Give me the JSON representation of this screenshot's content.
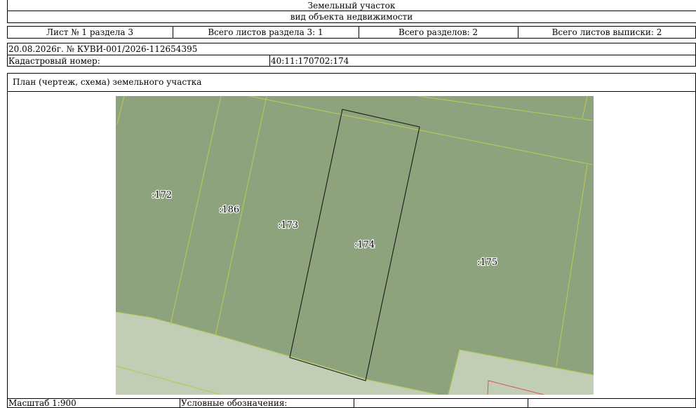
{
  "header": {
    "object_name": "Земельный участок",
    "object_type_caption": "вид объекта недвижимости"
  },
  "sheet_info": {
    "sheet": "Лист № 1 раздела 3",
    "section_sheets_total": "Всего листов раздела 3: 1",
    "sections_total": "Всего разделов: 2",
    "extract_sheets_total": "Всего листов выписки: 2"
  },
  "record": {
    "date_number": "20.08.2026г. № КУВИ-001/2026-112654395",
    "cadastral_label": "Кадастровый номер:",
    "cadastral_value": "40:11:170702:174"
  },
  "plan": {
    "title": "План (чертеж, схема) земельного участка",
    "parcel_labels": [
      ":172",
      ":186",
      ":173",
      ":174",
      ":175"
    ],
    "colors": {
      "parcel_fill": "#8ca37e",
      "road_fill": "#c2cdb6",
      "boundary": "#b4cc55",
      "highlight": "#1a1a1a",
      "red_marker": "#e05050"
    }
  },
  "footer": {
    "scale": "Масштаб 1:900",
    "legend_label": "Условные обозначения:"
  }
}
